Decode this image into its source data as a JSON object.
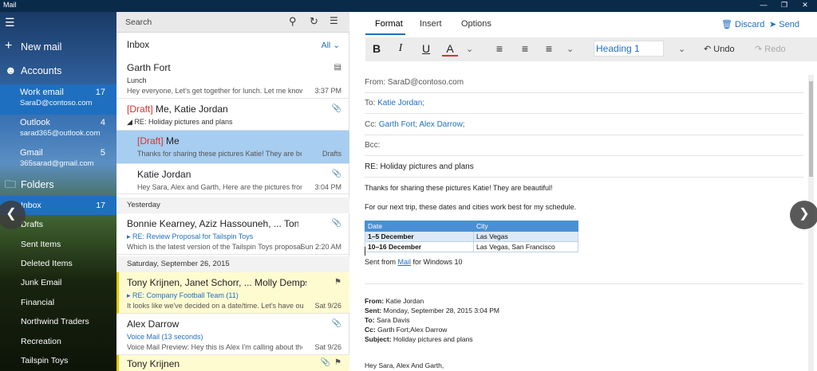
{
  "window": {
    "title": "Mail"
  },
  "sidebar": {
    "new_mail": "New mail",
    "accounts_label": "Accounts",
    "accounts": [
      {
        "name": "Work email",
        "address": "SaraD@contoso.com",
        "count": "17"
      },
      {
        "name": "Outlook",
        "address": "sarad365@outlook.com",
        "count": "4"
      },
      {
        "name": "Gmail",
        "address": "365sarad@gmail.com",
        "count": "5"
      }
    ],
    "folders_label": "Folders",
    "folders": [
      {
        "name": "Inbox",
        "count": "17"
      },
      {
        "name": "Drafts",
        "count": ""
      },
      {
        "name": "Sent Items",
        "count": ""
      },
      {
        "name": "Deleted Items",
        "count": ""
      },
      {
        "name": "Junk Email",
        "count": ""
      },
      {
        "name": "Financial",
        "count": ""
      },
      {
        "name": "Northwind Traders",
        "count": ""
      },
      {
        "name": "Recreation",
        "count": ""
      },
      {
        "name": "Tailspin Toys",
        "count": ""
      }
    ]
  },
  "list": {
    "search_placeholder": "Search",
    "title": "Inbox",
    "filter": "All",
    "messages": [
      {
        "from": "Garth Fort",
        "subject": "Lunch",
        "preview": "Hey everyone, Let's get together for lunch. Let me know if y",
        "time": "3:37 PM"
      },
      {
        "draft": "[Draft]",
        "from": " Me, Katie Jordan",
        "subject": "RE: Holiday pictures and plans",
        "preview": "",
        "time": ""
      },
      {
        "draft": "[Draft]",
        "from": " Me",
        "subject": "",
        "preview": "Thanks for sharing these pictures Katie! They are beauti",
        "time": "Drafts"
      },
      {
        "from": "Katie Jordan",
        "subject": "",
        "preview": "Hey Sara, Alex and Garth, Here are the pictures from our",
        "time": "3:04 PM"
      },
      {
        "from": "Bonnie Kearney, Aziz Hassouneh, ... Tony I",
        "subject": "RE: Review Proposal for Tailspin Toys",
        "preview": "Which is the latest version of the Tailspin Toys proposal?",
        "time": "Sun 2:20 AM"
      },
      {
        "from": "Tony Krijnen, Janet Schorr, ... Molly Dempsey",
        "subject": "RE: Company Football Team (11)",
        "preview": "It looks like we've decided on a date/time. Let's have our dir",
        "time": "Sat 9/26"
      },
      {
        "from": "Alex Darrow",
        "subject": "Voice Mail (13 seconds)",
        "preview": "Voice Mail Preview: Hey this is Alex I'm calling about the proj",
        "time": "Sat 9/26"
      },
      {
        "from": "Tony Krijnen",
        "subject": "",
        "preview": "",
        "time": ""
      }
    ],
    "sections": [
      "Yesterday",
      "Saturday, September 26, 2015"
    ]
  },
  "compose": {
    "tabs": [
      "Format",
      "Insert",
      "Options"
    ],
    "discard": "Discard",
    "send": "Send",
    "style": "Heading 1",
    "undo": "Undo",
    "redo": "Redo",
    "from": "From: SaraD@contoso.com",
    "to_label": "To: ",
    "to_value": "Katie Jordan;",
    "cc_label": "Cc: ",
    "cc_value": "Garth Fort; Alex Darrow;",
    "bcc_label": "Bcc:",
    "subject": "RE: Holiday pictures and plans",
    "body_line1": "Thanks for sharing these pictures Katie! They are beautiful!",
    "body_line2": "For our next trip, these dates and cities work best for my schedule.",
    "table": {
      "headers": [
        "Date",
        "City"
      ],
      "rows": [
        [
          "1–5 December",
          "Las Vegas"
        ],
        [
          "10–16 December",
          "Las Vegas, San Francisco"
        ]
      ]
    },
    "sig_prefix": "Sent from ",
    "sig_link": "Mail",
    "sig_suffix": " for Windows 10",
    "quote": {
      "from_label": "From:",
      "from": " Katie Jordan",
      "sent_label": "Sent:",
      "sent": " Monday, September 28, 2015 3:04 PM",
      "to_label": "To:",
      "to": " Sara Davis",
      "cc_label": "Cc:",
      "cc": " Garth Fort;Alex Darrow",
      "subject_label": "Subject:",
      "subject": " Holiday pictures and plans",
      "greeting": "Hey Sara, Alex And Garth,"
    }
  }
}
